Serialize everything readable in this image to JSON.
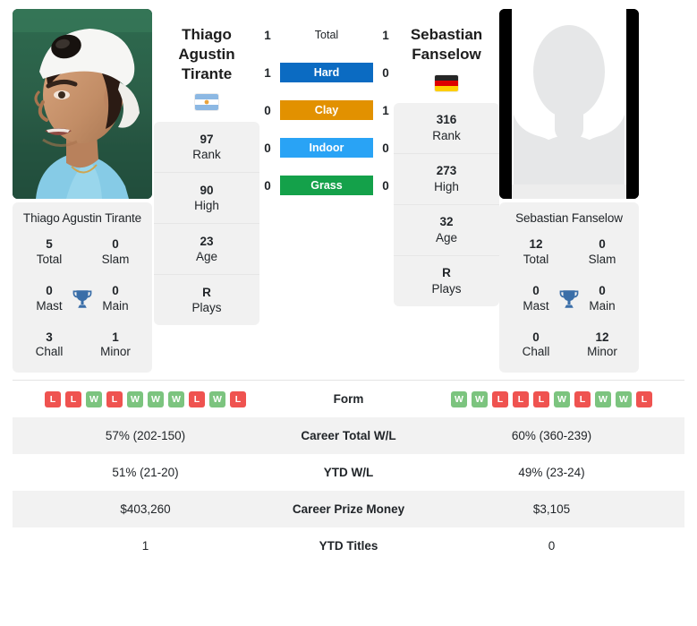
{
  "colors": {
    "hard": "#0b6bc2",
    "clay": "#e29100",
    "indoor": "#29a3f5",
    "grass": "#14a14a",
    "win": "#7cc47f",
    "loss": "#ef5350",
    "trophy": "#3a6ea8",
    "card_bg": "#f1f1f1",
    "row_shade": "#f2f2f2"
  },
  "players": {
    "left": {
      "name": "Thiago Agustin Tirante",
      "name_line1": "Thiago Agustin",
      "name_line2": "Tirante",
      "photo_type": "player-photo",
      "country": "Argentina",
      "flag_icon": "flag-argentina-icon",
      "stats": [
        {
          "value": "97",
          "label": "Rank"
        },
        {
          "value": "90",
          "label": "High"
        },
        {
          "value": "23",
          "label": "Age"
        },
        {
          "value": "R",
          "label": "Plays"
        }
      ],
      "titles": [
        {
          "value": "5",
          "label": "Total"
        },
        {
          "value": "0",
          "label": "Slam"
        },
        {
          "value": "0",
          "label": "Mast"
        },
        {
          "value": "0",
          "label": "Main"
        },
        {
          "value": "3",
          "label": "Chall"
        },
        {
          "value": "1",
          "label": "Minor"
        }
      ],
      "form": [
        "L",
        "L",
        "W",
        "L",
        "W",
        "W",
        "W",
        "L",
        "W",
        "L"
      ]
    },
    "right": {
      "name": "Sebastian Fanselow",
      "name_line1": "Sebastian",
      "name_line2": "Fanselow",
      "photo_type": "placeholder-silhouette",
      "country": "Germany",
      "flag_icon": "flag-germany-icon",
      "stats": [
        {
          "value": "316",
          "label": "Rank"
        },
        {
          "value": "273",
          "label": "High"
        },
        {
          "value": "32",
          "label": "Age"
        },
        {
          "value": "R",
          "label": "Plays"
        }
      ],
      "titles": [
        {
          "value": "12",
          "label": "Total"
        },
        {
          "value": "0",
          "label": "Slam"
        },
        {
          "value": "0",
          "label": "Mast"
        },
        {
          "value": "0",
          "label": "Main"
        },
        {
          "value": "0",
          "label": "Chall"
        },
        {
          "value": "12",
          "label": "Minor"
        }
      ],
      "form": [
        "W",
        "W",
        "L",
        "L",
        "L",
        "W",
        "L",
        "W",
        "W",
        "L"
      ]
    }
  },
  "surfaces": [
    {
      "label": "Total",
      "left": "1",
      "right": "1",
      "style": "plain"
    },
    {
      "label": "Hard",
      "left": "1",
      "right": "0",
      "style": "hard"
    },
    {
      "label": "Clay",
      "left": "0",
      "right": "1",
      "style": "clay"
    },
    {
      "label": "Indoor",
      "left": "0",
      "right": "0",
      "style": "indoor"
    },
    {
      "label": "Grass",
      "left": "0",
      "right": "0",
      "style": "grass"
    }
  ],
  "comparison_rows": [
    {
      "label": "Form",
      "left": "",
      "right": "",
      "type": "form"
    },
    {
      "label": "Career Total W/L",
      "left": "57% (202-150)",
      "right": "60% (360-239)",
      "type": "text"
    },
    {
      "label": "YTD W/L",
      "left": "51% (21-20)",
      "right": "49% (23-24)",
      "type": "text"
    },
    {
      "label": "Career Prize Money",
      "left": "$403,260",
      "right": "$3,105",
      "type": "text"
    },
    {
      "label": "YTD Titles",
      "left": "1",
      "right": "0",
      "type": "text"
    }
  ]
}
